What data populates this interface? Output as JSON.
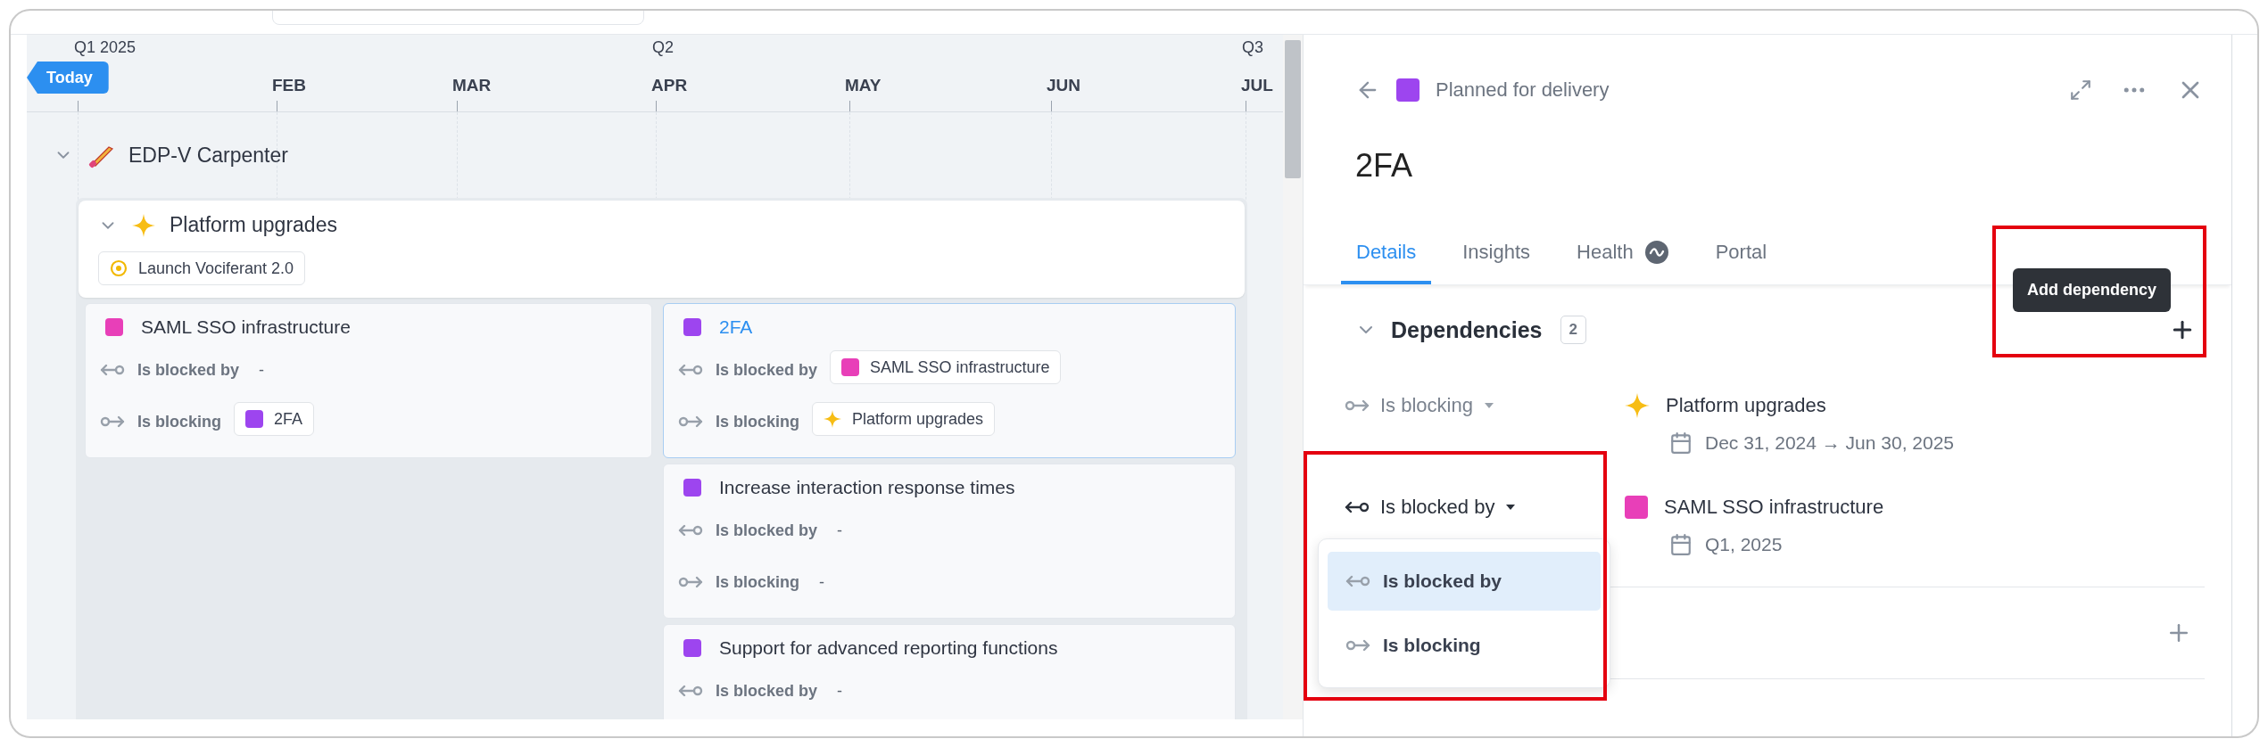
{
  "timeline": {
    "today": "Today",
    "columns": [
      {
        "quarter": "Q1 2025"
      },
      {
        "month": "FEB"
      },
      {
        "month": "MAR"
      },
      {
        "quarter": "Q2",
        "month": "APR"
      },
      {
        "month": "MAY"
      },
      {
        "month": "JUN"
      },
      {
        "quarter": "Q3",
        "month": "JUL"
      }
    ]
  },
  "group": {
    "name": "EDP-V Carpenter",
    "expanded": true,
    "initiative": {
      "name": "Platform upgrades",
      "expanded": true,
      "milestones": [
        "Launch Vociferant 2.0"
      ],
      "lanes": [
        [
          {
            "title": "SAML SSO infrastructure",
            "color": "#e83fb8",
            "selected": false,
            "links": [
              {
                "kind": "blocked_by",
                "label": "Is blocked by",
                "empty": "-"
              },
              {
                "kind": "blocking",
                "label": "Is blocking",
                "targets": [
                  {
                    "kind": "feature",
                    "name": "2FA",
                    "color": "#9d45ef"
                  }
                ]
              }
            ]
          }
        ],
        [
          {
            "title": "2FA",
            "color": "#9d45ef",
            "selected": true,
            "links": [
              {
                "kind": "blocked_by",
                "label": "Is blocked by",
                "targets": [
                  {
                    "kind": "feature",
                    "name": "SAML SSO infrastructure",
                    "color": "#e83fb8"
                  }
                ]
              },
              {
                "kind": "blocking",
                "label": "Is blocking",
                "targets": [
                  {
                    "kind": "initiative",
                    "name": "Platform upgrades"
                  }
                ]
              }
            ]
          },
          {
            "title": "Increase interaction response times",
            "color": "#9d45ef",
            "selected": false,
            "links": [
              {
                "kind": "blocked_by",
                "label": "Is blocked by",
                "empty": "-"
              },
              {
                "kind": "blocking",
                "label": "Is blocking",
                "empty": "-"
              }
            ]
          },
          {
            "title": "Support for advanced reporting functions",
            "color": "#9d45ef",
            "selected": false,
            "links": [
              {
                "kind": "blocked_by",
                "label": "Is blocked by",
                "empty": "-"
              }
            ]
          }
        ]
      ]
    }
  },
  "details": {
    "status": {
      "label": "Planned for delivery",
      "color": "#9d45ef"
    },
    "title": "2FA",
    "tabs": [
      {
        "label": "Details",
        "selected": true,
        "kind": "plain"
      },
      {
        "label": "Insights",
        "selected": false,
        "kind": "plain"
      },
      {
        "label": "Health",
        "selected": false,
        "kind": "health"
      },
      {
        "label": "Portal",
        "selected": false,
        "kind": "plain"
      }
    ],
    "tooltip": "Add dependency",
    "dependencies": {
      "title": "Dependencies",
      "count": "2",
      "expanded": true,
      "rows": [
        {
          "relation": "Is blocking",
          "kind": "blocking",
          "open": false,
          "target": {
            "kind": "initiative",
            "name": "Platform upgrades"
          },
          "date": "Dec 31, 2024 → Jun 30, 2025"
        },
        {
          "relation": "Is blocked by",
          "kind": "blocked_by",
          "open": true,
          "target": {
            "kind": "feature",
            "name": "SAML SSO infrastructure",
            "color": "#e83fb8"
          },
          "date": "Q1, 2025"
        }
      ],
      "menu": [
        {
          "label": "Is blocked by",
          "kind": "blocked_by",
          "selected": true
        },
        {
          "label": "Is blocking",
          "kind": "blocking",
          "selected": false
        }
      ]
    }
  }
}
